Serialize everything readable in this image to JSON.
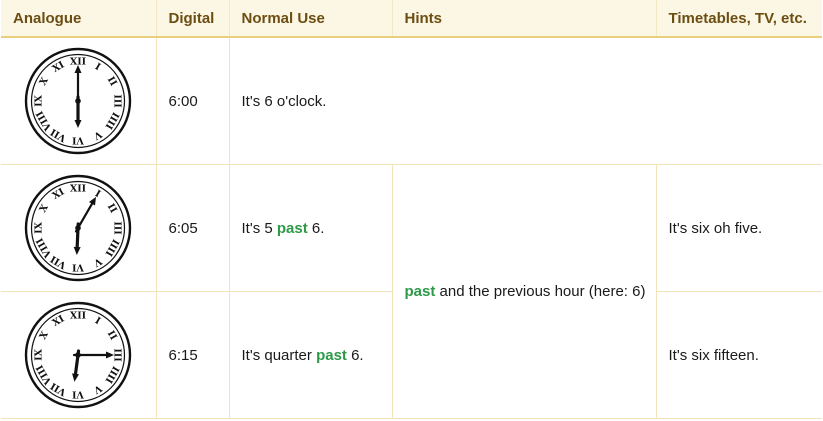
{
  "headers": {
    "analogue": "Analogue",
    "digital": "Digital",
    "normal": "Normal Use",
    "hints": "Hints",
    "timetables": "Timetables, TV, etc."
  },
  "rows": [
    {
      "clock": {
        "hour": 6,
        "minute": 0
      },
      "digital": "6:00",
      "normal": {
        "prefix": "It's 6 o'clock.",
        "keyword": "",
        "suffix": ""
      },
      "timetable": ""
    },
    {
      "clock": {
        "hour": 6,
        "minute": 5
      },
      "digital": "6:05",
      "normal": {
        "prefix": "It's 5 ",
        "keyword": "past",
        "suffix": " 6."
      },
      "timetable": "It's six oh five."
    },
    {
      "clock": {
        "hour": 6,
        "minute": 15
      },
      "digital": "6:15",
      "normal": {
        "prefix": "It's quarter ",
        "keyword": "past",
        "suffix": " 6."
      },
      "timetable": "It's six fifteen."
    }
  ],
  "hint": {
    "keyword": "past",
    "text": " and the previous hour (here: 6)"
  },
  "clock_numerals": [
    "XII",
    "I",
    "II",
    "III",
    "IIII",
    "V",
    "VI",
    "VII",
    "VIII",
    "IX",
    "X",
    "XI"
  ]
}
